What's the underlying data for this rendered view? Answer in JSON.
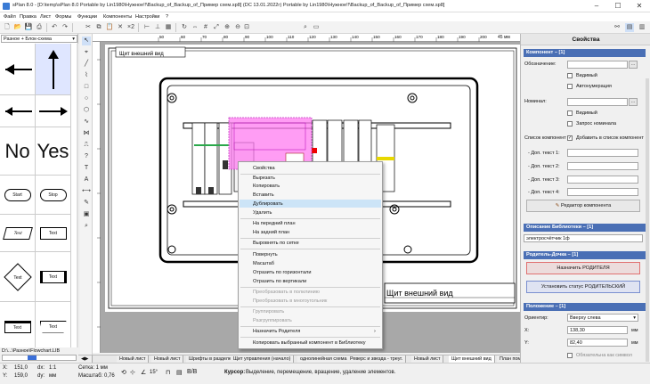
{
  "window": {
    "title": "sPlan 8.0 - [D:\\temp\\sPlan 8.0 Portable by Lin1980\\Нужное!!\\Backup_of_Backup_of_Пример схем.sp8] (DC 13.01.2022г) Portable by Lin1980\\Нужное!!\\Backup_of_Backup_of_Пример схем.sp8]"
  },
  "menu": [
    "Файл",
    "Правка",
    "Лист",
    "Формы",
    "Функции",
    "Компоненты",
    "Настройки",
    "?"
  ],
  "toolbar": {
    "zoom": "Ф",
    "ruler_unit": "45 мм"
  },
  "library": {
    "selector": "Разное + Блок-схема",
    "path": "D:\\...\\Разное\\Flowchart.LIB",
    "cells": [
      "No",
      "Yes",
      "Start",
      "Stop",
      "Text",
      "Text",
      "Text",
      "Text",
      "Text",
      "Text"
    ]
  },
  "ruler_ticks": [
    "50",
    "60",
    "70",
    "80",
    "90",
    "100",
    "110",
    "120",
    "130",
    "140",
    "150",
    "160",
    "170",
    "180",
    "190",
    "200"
  ],
  "drawing": {
    "stamp_label": "Щит внешний вид",
    "left_label": "Щит внешний вид",
    "small_top": "Щит внешний вид"
  },
  "context_menu": {
    "items": [
      {
        "label": "Свойства",
        "disabled": false
      },
      {
        "label": "Вырезать",
        "disabled": false
      },
      {
        "label": "Копировать",
        "disabled": false
      },
      {
        "label": "Вставить",
        "disabled": false
      },
      {
        "label": "Дублировать",
        "disabled": false,
        "highlighted": true
      },
      {
        "label": "Удалить",
        "disabled": false
      },
      {
        "label": "На передний план",
        "disabled": false
      },
      {
        "label": "На задний план",
        "disabled": false
      },
      {
        "label": "Выровнять по сетке",
        "disabled": false
      },
      {
        "label": "Повернуть",
        "disabled": false
      },
      {
        "label": "Масштаб",
        "disabled": false
      },
      {
        "label": "Отразить по горизонтали",
        "disabled": false
      },
      {
        "label": "Отразить по вертикали",
        "disabled": false
      },
      {
        "label": "Преобразовать в полилинию",
        "disabled": true
      },
      {
        "label": "Преобразовать в многоугольник",
        "disabled": true
      },
      {
        "label": "Группировать",
        "disabled": true
      },
      {
        "label": "Разгруппировать",
        "disabled": true
      },
      {
        "label": "Назначить Родителя",
        "disabled": false,
        "submenu": true
      },
      {
        "label": "Копировать выбранный компонент в Библиотеку",
        "disabled": false
      }
    ]
  },
  "tabs": [
    "Новый лист",
    "Новый лист",
    "Шрифты в разделе",
    "Щит управления (начало)",
    "однолинейная схема",
    "Реверс и звезда - треуг.",
    "Новый лист",
    "Щит внешний вид",
    "План помещений"
  ],
  "active_tab": "Щит внешний вид",
  "status": {
    "x_label": "X:",
    "x_value": "151,0",
    "y_label": "Y:",
    "y_value": "159,0",
    "dx_label": "dx:",
    "dx_value": "1:1",
    "dy_label": "dy:",
    "dy_value": "мм",
    "grid": "Сетка: 1 мм",
    "scale": "Масштаб: 0,76",
    "angle": "15°",
    "hint_label": "Курсор:",
    "hint": "Выделение, перемещение, вращение, удаление элементов."
  },
  "properties": {
    "title": "Свойства",
    "component_section": "Компонент",
    "designation_label": "Обозначение:",
    "visible_label": "Видимый",
    "autonum_label": "Автонумерация",
    "nominal_label": "Номинал:",
    "visible2_label": "Видимый",
    "query_nominal_label": "Запрос номинала",
    "list_label": "Список компонент",
    "add_to_list_label": "Добавить в список компонент",
    "extra1": "- Доп. текст 1:",
    "extra2": "- Доп. текст 2:",
    "extra3": "- Доп. текст 3:",
    "extra4": "- Доп. текст 4:",
    "editor_button": "Редактор компонента",
    "library_section": "Описание Библиотеки",
    "library_value": "электросчётчик 1ф",
    "parent_section": "Родитель-Дочка",
    "assign_parent": "Назначить РОДИТЕЛЯ",
    "set_parent_status": "Установить статус РОДИТЕЛЬСКИЙ",
    "position_section": "Положение",
    "orient_label": "Ориентир:",
    "orient_value": "Вверху слева",
    "x_label": "X:",
    "x_value": "138,30",
    "x_unit": "мм",
    "y_label": "Y:",
    "y_value": "82,40",
    "y_unit": "мм",
    "lock_label": "Обязательна как символ"
  },
  "colors": {
    "accent": "#4a6fb5",
    "selection": "#ff7cf0",
    "highlight": "#cce4f7"
  }
}
